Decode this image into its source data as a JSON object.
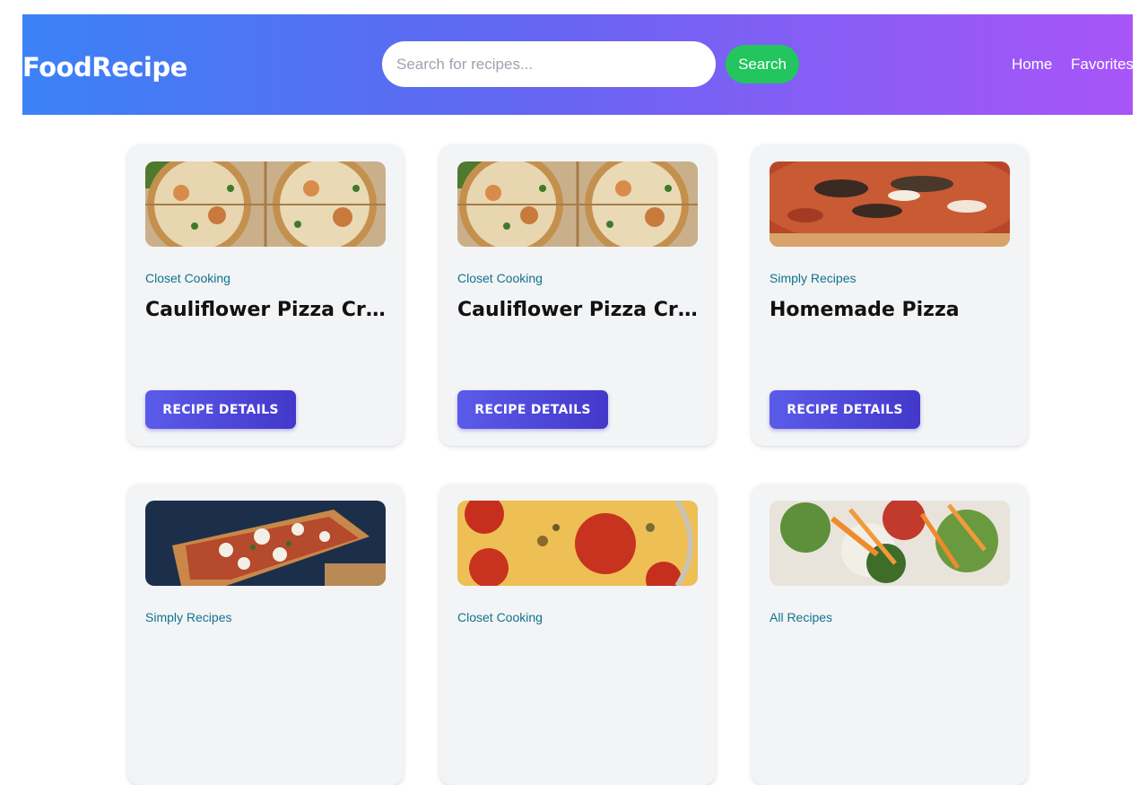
{
  "header": {
    "logo": "FoodRecipe",
    "search_placeholder": "Search for recipes...",
    "search_value": "",
    "search_button": "Search",
    "nav": {
      "home": "Home",
      "favorites": "Favorites"
    }
  },
  "recipes": [
    {
      "publisher": "Closet Cooking",
      "title": "Cauliflower Pizza Crust",
      "button": "RECIPE DETAILS",
      "image": "cauliflower-pizza"
    },
    {
      "publisher": "Closet Cooking",
      "title": "Cauliflower Pizza Crust",
      "button": "RECIPE DETAILS",
      "image": "cauliflower-pizza"
    },
    {
      "publisher": "Simply Recipes",
      "title": "Homemade Pizza",
      "button": "RECIPE DETAILS",
      "image": "homemade-pizza"
    },
    {
      "publisher": "Simply Recipes",
      "title": "",
      "button": "",
      "image": "grilled-pizza"
    },
    {
      "publisher": "Closet Cooking",
      "title": "",
      "button": "",
      "image": "pepperoni-pizza"
    },
    {
      "publisher": "All Recipes",
      "title": "",
      "button": "",
      "image": "vegetable-salad"
    }
  ],
  "colors": {
    "publisher": "#0e7490",
    "search_button": "#22c55e",
    "recipe_button": "#4f46e5"
  }
}
